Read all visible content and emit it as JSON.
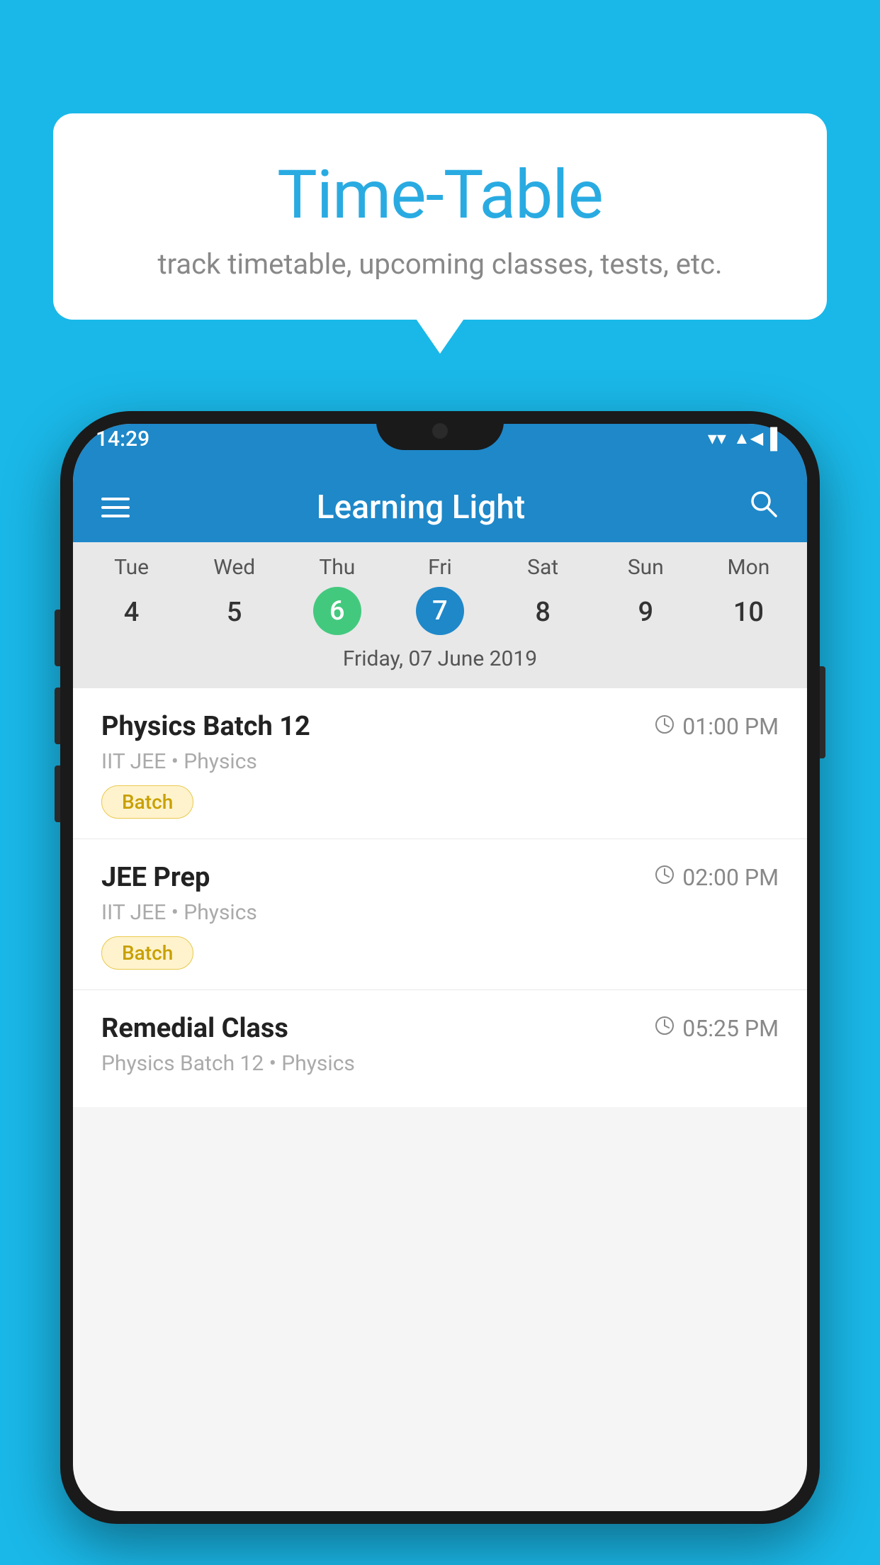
{
  "background_color": "#1ab8e8",
  "speech_bubble": {
    "title": "Time-Table",
    "subtitle": "track timetable, upcoming classes, tests, etc."
  },
  "phone": {
    "status_bar": {
      "time": "14:29"
    },
    "app_header": {
      "title": "Learning Light"
    },
    "calendar": {
      "days": [
        "Tue",
        "Wed",
        "Thu",
        "Fri",
        "Sat",
        "Sun",
        "Mon"
      ],
      "dates": [
        "4",
        "5",
        "6",
        "7",
        "8",
        "9",
        "10"
      ],
      "today_index": 2,
      "selected_index": 3,
      "selected_label": "Friday, 07 June 2019"
    },
    "schedule": [
      {
        "title": "Physics Batch 12",
        "time": "01:00 PM",
        "meta": "IIT JEE • Physics",
        "badge": "Batch"
      },
      {
        "title": "JEE Prep",
        "time": "02:00 PM",
        "meta": "IIT JEE • Physics",
        "badge": "Batch"
      },
      {
        "title": "Remedial Class",
        "time": "05:25 PM",
        "meta": "Physics Batch 12 • Physics",
        "badge": null
      }
    ]
  }
}
